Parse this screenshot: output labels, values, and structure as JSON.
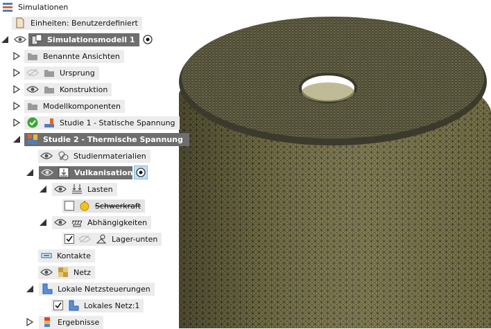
{
  "browser": {
    "root": {
      "label": "Simulationen",
      "icon": "simulations-icon"
    },
    "units": {
      "label": "Einheiten: Benutzerdefiniert",
      "icon": "document-icon"
    },
    "model": {
      "label": "Simulationsmodell 1",
      "icon": "simulation-model-icon"
    },
    "named_views": {
      "label": "Benannte Ansichten",
      "icon": "folder-icon"
    },
    "origin": {
      "label": "Ursprung",
      "icon": "folder-icon"
    },
    "construction": {
      "label": "Konstruktion",
      "icon": "folder-icon"
    },
    "model_components": {
      "label": "Modellkomponenten",
      "icon": "folder-icon"
    },
    "study1": {
      "label": "Studie 1 - Statische Spannung",
      "icon": "static-stress-study-icon",
      "status": "check-icon"
    },
    "study2": {
      "label": "Studie 2 - Thermische Spannung",
      "icon": "thermal-stress-study-icon"
    },
    "study_materials": {
      "label": "Studienmaterialien",
      "icon": "materials-icon"
    },
    "load_case": {
      "label": "Vulkanisation",
      "icon": "load-case-icon"
    },
    "loads": {
      "label": "Lasten",
      "icon": "loads-icon"
    },
    "gravity": {
      "label": "Schwerkraft",
      "icon": "gravity-icon",
      "checked": false
    },
    "constraints": {
      "label": "Abhängigkeiten",
      "icon": "constraints-icon"
    },
    "bearing": {
      "label": "Lager-unten",
      "icon": "bearing-icon",
      "checked": true
    },
    "contacts": {
      "label": "Kontakte",
      "icon": "contacts-icon"
    },
    "mesh": {
      "label": "Netz",
      "icon": "mesh-icon"
    },
    "local_mesh_controls": {
      "label": "Lokale Netzsteuerungen",
      "icon": "local-mesh-controls-icon"
    },
    "local_mesh": {
      "label": "Lokales Netz:1",
      "icon": "local-mesh-icon",
      "checked": true
    },
    "results": {
      "label": "Ergebnisse",
      "icon": "results-icon"
    }
  },
  "viewport": {
    "description_icon": "meshed-cylinder-model",
    "mesh_color": "#7a7448",
    "mesh_dark": "#3a3a2a",
    "background": "#ffffff"
  },
  "colors": {
    "selection": "#6e6e6e",
    "row_bg": "#ececec",
    "check_green": "#3aa53a",
    "radio_highlight": "#bfe0f5"
  }
}
